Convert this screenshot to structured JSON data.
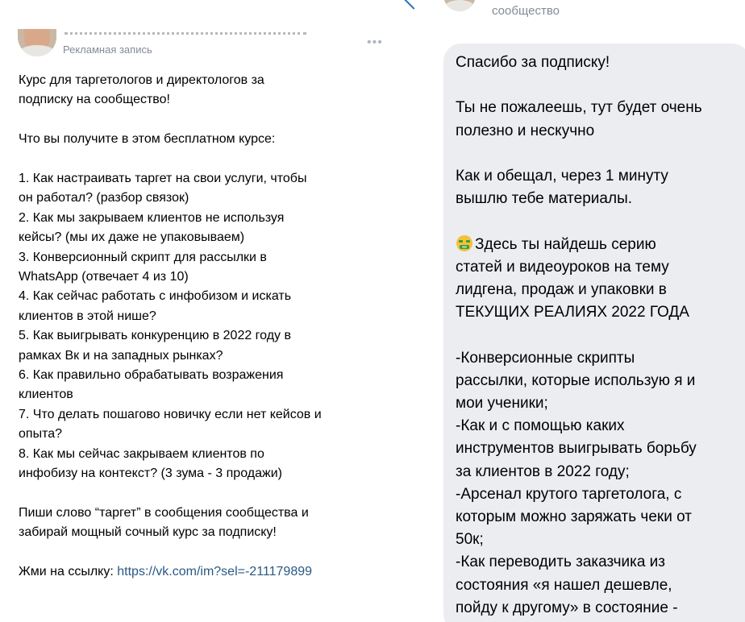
{
  "post": {
    "subtitle": "Рекламная запись",
    "more": "•••",
    "title_lines": "Курс для таргетологов и директологов за\nподписку на сообщество!",
    "intro": "Что вы получите в этом бесплатном курсе:",
    "items": [
      "1. Как настраивать таргет на свои услуги, чтобы\nон работал? (разбор связок)",
      "2. Как мы закрываем клиентов не используя\nкейсы? (мы их даже не упаковываем)",
      "3. Конверсионный скрипт для рассылки в\nWhatsApp (отвечает 4 из 10)",
      "4. Как сейчас работать с инфобизом и искать\nклиентов в этой нише?",
      "5. Как выигрывать конкуренцию в 2022 году в\nрамках Вк и на западных рынках?",
      "6. Как правильно обрабатывать возражения\nклиентов",
      "7. Что делать пошагово новичку если нет кейсов и\nопыта?",
      "8. Как мы сейчас закрываем клиентов по\nинфобизу на контекст?   (3 зума - 3 продажи)"
    ],
    "cta": "Пиши слово “таргет” в сообщения сообщества и\nзабирай мощный сочный курс за подписку!",
    "link_prefix": "Жми на ссылку: ",
    "link_text": "https://vk.com/im?sel=-211179899"
  },
  "chat": {
    "subtitle": "сообщество",
    "paragraphs": {
      "thanks": "Спасибо за подписку!",
      "promise": "Ты не пожалеешь, тут будет очень\nполезно и нескучно",
      "materials": "Как и обещал, через 1 минуту\nвышлю тебе материалы.",
      "series": "Здесь ты найдешь серию\nстатей и видеоуроков на тему\nлидгена, продаж и упаковки в\nТЕКУЩИХ РЕАЛИЯХ 2022 ГОДА",
      "list": "-Конверсионные скрипты\nрассылки, которые использую я и\nмои ученики;\n-Как и с помощью каких\nинструментов выигрывать борьбу\nза клиентов в 2022 году;\n-Арсенал крутого таргетолога, с\nкоторым можно заряжать чеки от\n50к;\n-Как переводить заказчика из\nсостояния «я нашел дешевле,\nпойду к другому» в состояние  -\n«нифига себе, куда платить?»;"
    },
    "emoji_icon": "money-mouth-face-icon"
  },
  "colors": {
    "link": "#2a5885",
    "secondary_text": "#818c99",
    "bubble_bg": "#ebedf0",
    "back_chevron": "#2b71b8"
  }
}
